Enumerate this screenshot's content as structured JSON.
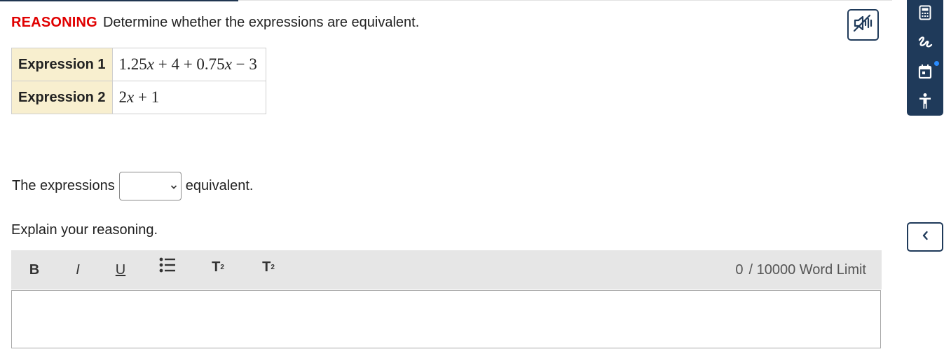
{
  "question": {
    "tag": "REASONING",
    "prompt": "Determine whether the expressions are equivalent."
  },
  "expressions": [
    {
      "label": "Expression 1",
      "value": "1.25x + 4 + 0.75x − 3"
    },
    {
      "label": "Expression 2",
      "value": "2x + 1"
    }
  ],
  "answer": {
    "prefix": "The expressions",
    "select_value": "",
    "suffix": "equivalent."
  },
  "explain": {
    "label": "Explain your reasoning."
  },
  "editor_toolbar": {
    "bold": "B",
    "italic": "I",
    "underline": "U",
    "superscript_base": "T",
    "superscript_mark": "2",
    "subscript_base": "T",
    "subscript_mark": "2",
    "word_count": "0",
    "word_limit": "/ 10000 Word Limit"
  },
  "icons": {
    "audio": "speaker-muted-icon",
    "calculator": "calculator-icon",
    "scribble": "scribble-icon",
    "calendar": "calendar-icon",
    "accessibility": "accessibility-icon",
    "collapse": "chevron-left-icon"
  },
  "colors": {
    "accent": "#1f3a5a",
    "tag_red": "#e00000",
    "label_bg": "#f8efcf",
    "notify": "#2a8cff"
  }
}
